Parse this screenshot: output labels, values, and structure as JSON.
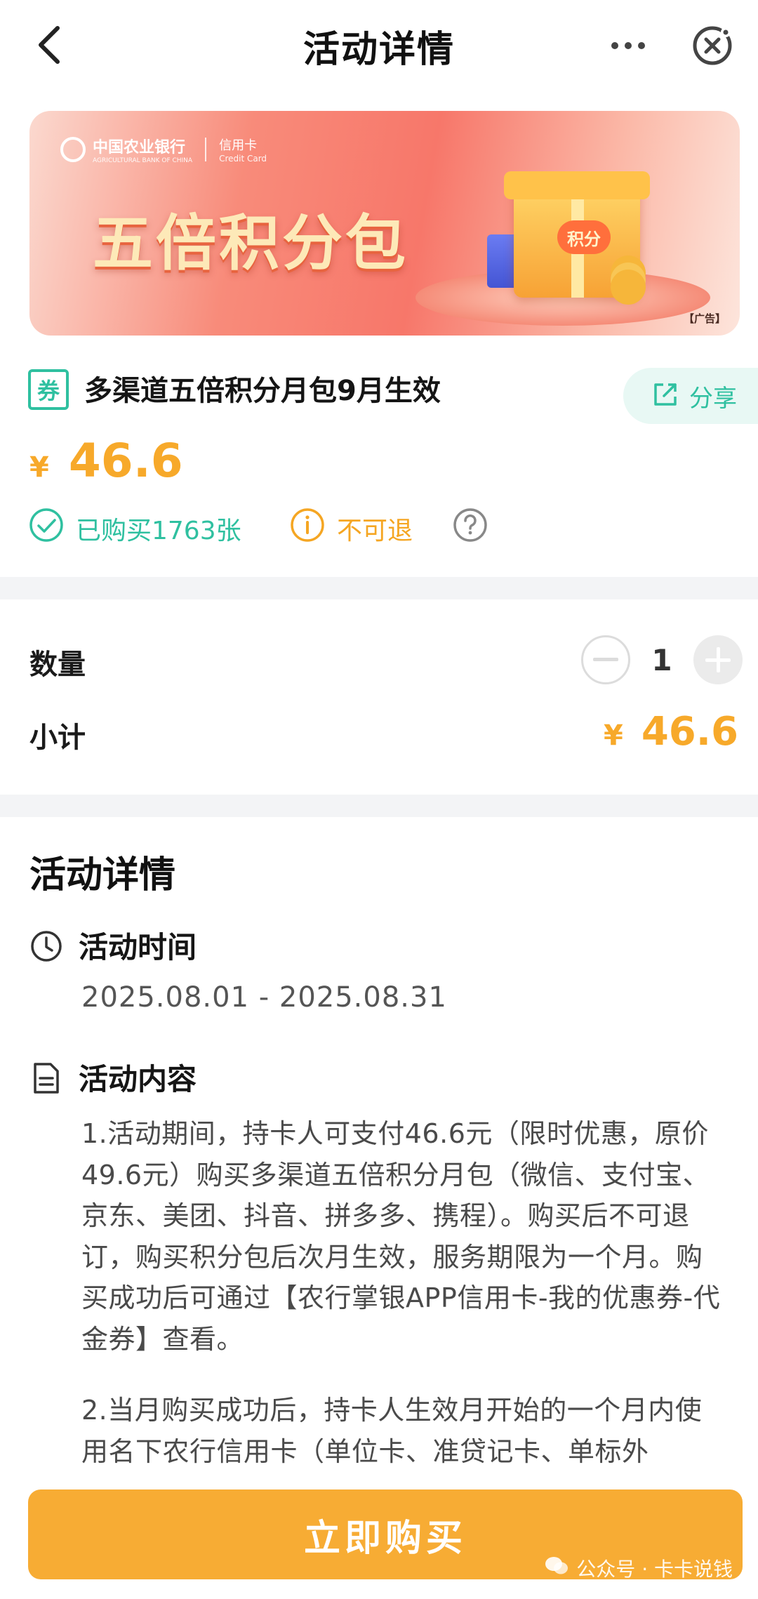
{
  "nav": {
    "title": "活动详情",
    "back_icon": "chevron-left-icon",
    "more_icon": "more-dots-icon",
    "close_icon": "close-circle-icon"
  },
  "banner": {
    "bank_name_cn": "中国农业银行",
    "bank_name_en": "AGRICULTURAL BANK OF CHINA",
    "card_type_cn": "信用卡",
    "card_type_en": "Credit Card",
    "headline": "五倍积分包",
    "gift_label": "积分",
    "ad_label": "【广告】"
  },
  "product": {
    "tag": "券",
    "title": "多渠道五倍积分月包9月生效",
    "share_label": "分享",
    "currency": "¥",
    "price": "46.6",
    "sold_text": "已购买1763张",
    "refund_text": "不可退"
  },
  "order": {
    "quantity_label": "数量",
    "quantity_value": "1",
    "subtotal_label": "小计",
    "subtotal_currency": "¥",
    "subtotal_value": "46.6"
  },
  "details": {
    "section_title": "活动详情",
    "time_heading": "活动时间",
    "time_range": "2025.08.01 - 2025.08.31",
    "content_heading": "活动内容",
    "paragraph_1": "1.活动期间，持卡人可支付46.6元（限时优惠，原价49.6元）购买多渠道五倍积分月包（微信、支付宝、京东、美团、抖音、拼多多、携程）。购买后不可退订，购买积分包后次月生效，服务期限为一个月。购买成功后可通过【农行掌银APP信用卡-我的优惠券-代金券】查看。",
    "paragraph_2": "2.当月购买成功后，持卡人生效月开始的一个月内使用名下农行信用卡（单位卡、准贷记卡、单标外"
  },
  "footer": {
    "buy_label": "立即购买",
    "watermark": "公众号 · 卡卡说钱"
  },
  "colors": {
    "accent_green": "#2fc0a0",
    "price_orange": "#f7a92a",
    "buy_button": "#f7ac34"
  }
}
